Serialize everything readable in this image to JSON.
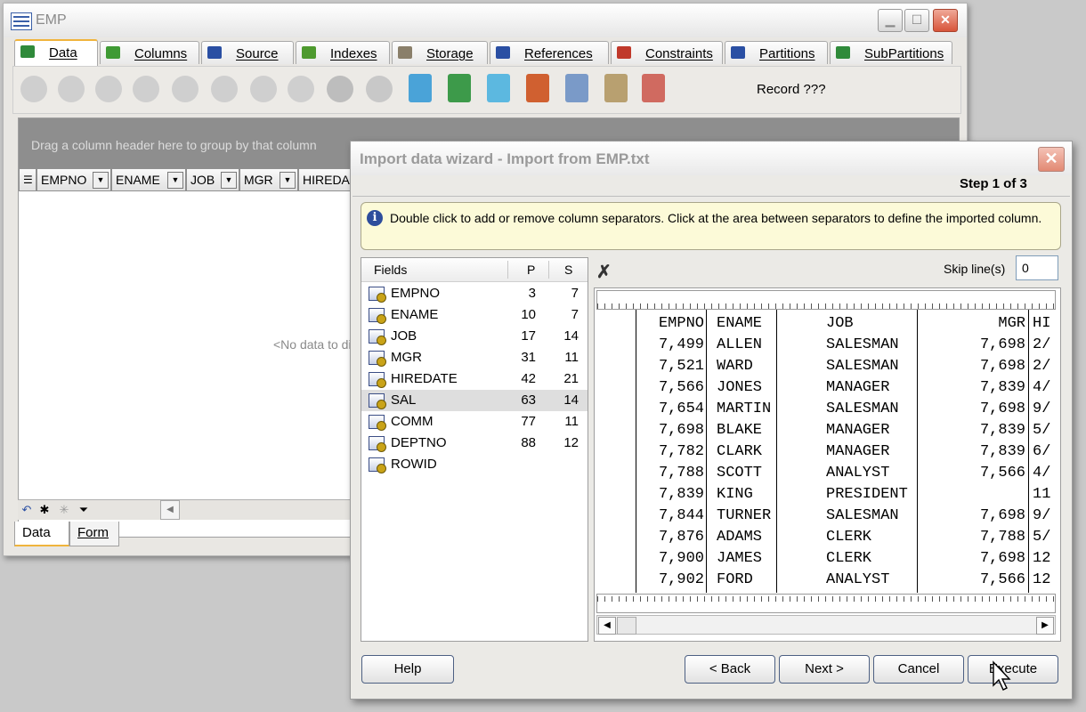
{
  "main_window": {
    "title": "EMP",
    "tabs": [
      {
        "label": "Data",
        "icon": "grid-icon",
        "color": "#2f8a3a"
      },
      {
        "label": "Columns",
        "icon": "columns-icon",
        "color": "#3f9a34"
      },
      {
        "label": "Source",
        "icon": "sql-icon",
        "color": "#2a4fa3"
      },
      {
        "label": "Indexes",
        "icon": "indexes-icon",
        "color": "#4e9a2f"
      },
      {
        "label": "Storage",
        "icon": "storage-icon",
        "color": "#8a7f6a"
      },
      {
        "label": "References",
        "icon": "references-icon",
        "color": "#2a4fa3"
      },
      {
        "label": "Constraints",
        "icon": "constraints-icon",
        "color": "#c0392b"
      },
      {
        "label": "Partitions",
        "icon": "partitions-icon",
        "color": "#2a4fa3"
      },
      {
        "label": "SubPartitions",
        "icon": "subpartitions-icon",
        "color": "#2f8a3a"
      }
    ],
    "toolbar": {
      "record_label": "Record ???"
    },
    "grid": {
      "group_hint": "Drag a column header here to group by that column",
      "columns": [
        "EMPNO",
        "ENAME",
        "JOB",
        "MGR",
        "HIREDA"
      ],
      "no_data": "<No data to disp"
    },
    "bottom_tabs": [
      "Data",
      "Form"
    ]
  },
  "wizard": {
    "title": "Import data wizard - Import from EMP.txt",
    "step": "Step 1 of 3",
    "info": "Double click to add or remove column separators. Click at the area between separators to define the imported column.",
    "fields_header": {
      "name": "Fields",
      "p": "P",
      "s": "S"
    },
    "fields": [
      {
        "name": "EMPNO",
        "p": "3",
        "s": "7"
      },
      {
        "name": "ENAME",
        "p": "10",
        "s": "7"
      },
      {
        "name": "JOB",
        "p": "17",
        "s": "14"
      },
      {
        "name": "MGR",
        "p": "31",
        "s": "11"
      },
      {
        "name": "HIREDATE",
        "p": "42",
        "s": "21"
      },
      {
        "name": "SAL",
        "p": "63",
        "s": "14"
      },
      {
        "name": "COMM",
        "p": "77",
        "s": "11"
      },
      {
        "name": "DEPTNO",
        "p": "88",
        "s": "12"
      },
      {
        "name": "ROWID",
        "p": "",
        "s": ""
      }
    ],
    "selected_field": "SAL",
    "skip_label": "Skip line(s)",
    "skip_value": "0",
    "preview_rows": [
      [
        "EMPNO",
        "ENAME",
        "JOB",
        "MGR",
        "HI"
      ],
      [
        "7,499",
        "ALLEN",
        "SALESMAN",
        "7,698",
        "2/"
      ],
      [
        "7,521",
        "WARD",
        "SALESMAN",
        "7,698",
        "2/"
      ],
      [
        "7,566",
        "JONES",
        "MANAGER",
        "7,839",
        "4/"
      ],
      [
        "7,654",
        "MARTIN",
        "SALESMAN",
        "7,698",
        "9/"
      ],
      [
        "7,698",
        "BLAKE",
        "MANAGER",
        "7,839",
        "5/"
      ],
      [
        "7,782",
        "CLARK",
        "MANAGER",
        "7,839",
        "6/"
      ],
      [
        "7,788",
        "SCOTT",
        "ANALYST",
        "7,566",
        "4/"
      ],
      [
        "7,839",
        "KING",
        "PRESIDENT",
        "",
        "11"
      ],
      [
        "7,844",
        "TURNER",
        "SALESMAN",
        "7,698",
        "9/"
      ],
      [
        "7,876",
        "ADAMS",
        "CLERK",
        "7,788",
        "5/"
      ],
      [
        "7,900",
        "JAMES",
        "CLERK",
        "7,698",
        "12"
      ],
      [
        "7,902",
        "FORD",
        "ANALYST",
        "7,566",
        "12"
      ]
    ],
    "buttons": {
      "help": "Help",
      "back": "< Back",
      "next": "Next >",
      "cancel": "Cancel",
      "execute": "Execute"
    }
  }
}
